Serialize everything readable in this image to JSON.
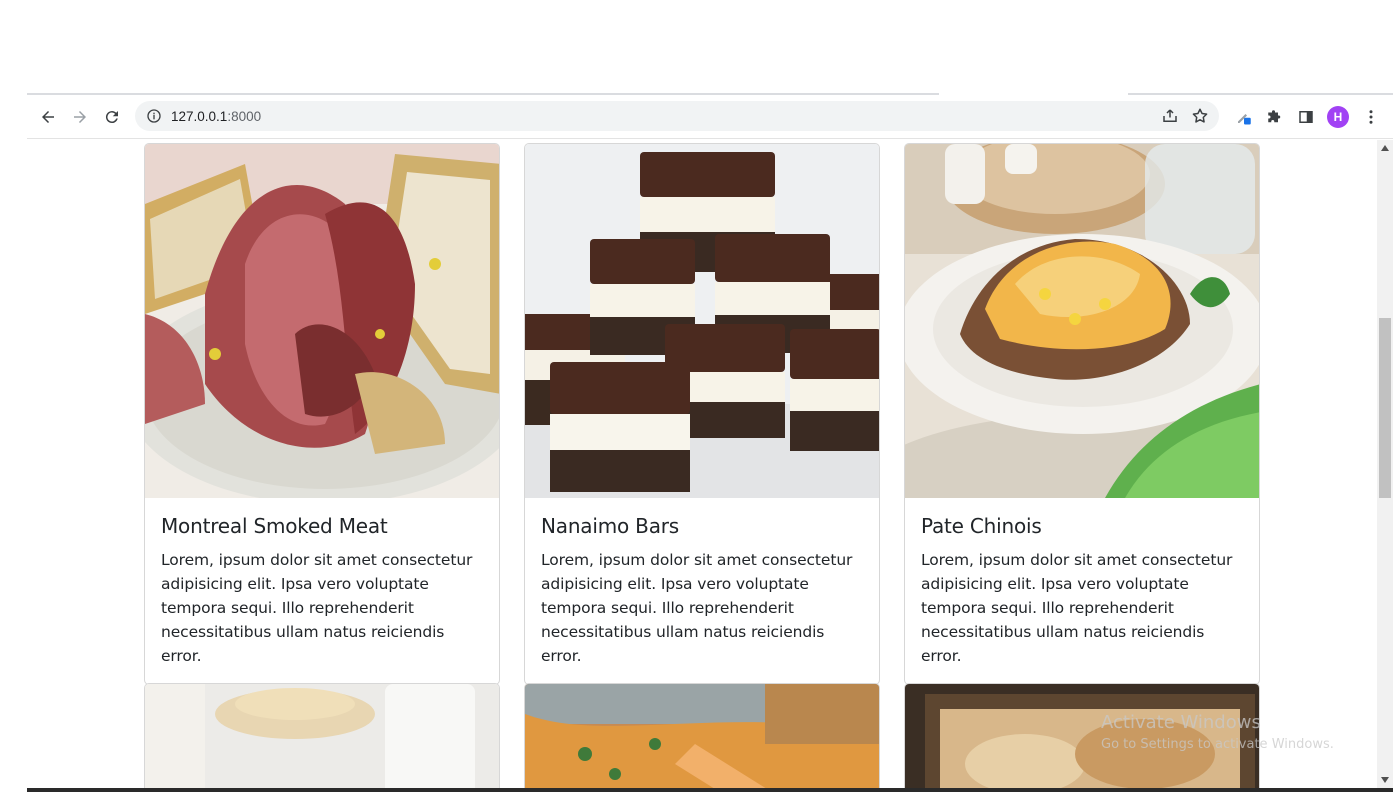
{
  "browser": {
    "url_host": "127.0.0.1",
    "url_port": ":8000",
    "profile_initial": "H"
  },
  "cards": [
    {
      "title": "Montreal Smoked Meat",
      "text": "Lorem, ipsum dolor sit amet consectetur adipisicing elit. Ipsa vero voluptate tempora sequi. Illo reprehenderit necessitatibus ullam natus reiciendis error."
    },
    {
      "title": "Nanaimo Bars",
      "text": "Lorem, ipsum dolor sit amet consectetur adipisicing elit. Ipsa vero voluptate tempora sequi. Illo reprehenderit necessitatibus ullam natus reiciendis error."
    },
    {
      "title": "Pate Chinois",
      "text": "Lorem, ipsum dolor sit amet consectetur adipisicing elit. Ipsa vero voluptate tempora sequi. Illo reprehenderit necessitatibus ullam natus reiciendis error."
    }
  ],
  "watermark": {
    "title": "Activate Windows",
    "subtitle": "Go to Settings to activate Windows."
  },
  "icons": {
    "back": "arrow-left-icon",
    "forward": "arrow-right-icon",
    "reload": "reload-icon",
    "info": "info-icon",
    "share": "share-icon",
    "bookmark": "star-icon",
    "extension_edit": "pen-extension-icon",
    "extensions": "puzzle-icon",
    "side_panel": "side-panel-icon",
    "menu": "kebab-menu-icon"
  }
}
